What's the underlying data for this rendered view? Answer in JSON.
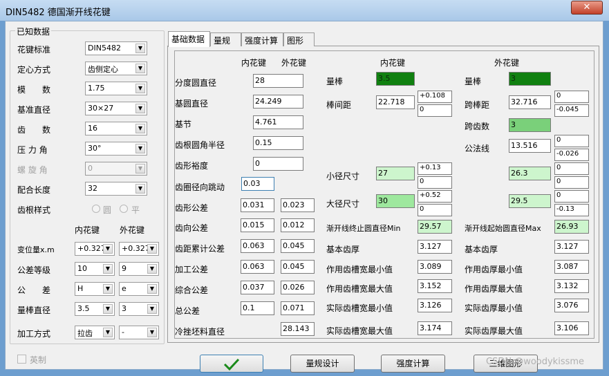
{
  "window": {
    "title": "DIN5482 德国渐开线花键",
    "close_icon": "✕"
  },
  "known": {
    "title": "已知数据",
    "labels": {
      "std": "花键标准",
      "center": "定心方式",
      "module": "模　　数",
      "base_d": "基准直径",
      "teeth": "齿　　数",
      "pressure": "压 力 角",
      "helix": "螺 旋 角",
      "length": "配合长度",
      "root_style": "齿根样式"
    },
    "values": {
      "std": "DIN5482",
      "center": "齿侧定心",
      "module": "1.75",
      "base_d": "30×27",
      "teeth": "16",
      "pressure": "30°",
      "helix": "0",
      "length": "32"
    },
    "root_opts": {
      "round": "圆",
      "flat": "平"
    },
    "col_inner": "内花键",
    "col_outer": "外花键",
    "rows": {
      "shift": "变位量x.m",
      "grade": "公差等级",
      "tol": "公　　差",
      "meas": "量棒直径",
      "proc": "加工方式"
    },
    "inner": {
      "shift": "+0.327",
      "grade": "10",
      "tol": "H",
      "meas": "3.5",
      "proc": "拉齿"
    },
    "outer": {
      "shift": "+0.327",
      "grade": "9",
      "tol": "e",
      "meas": "3",
      "proc": "-"
    },
    "english": "英制"
  },
  "tabs": [
    "基础数据",
    "量规",
    "强度计算",
    "图形"
  ],
  "basic": {
    "col_inner": "内花键",
    "col_outer": "外花键",
    "labels": {
      "pitch_d": "分度圆直径",
      "base_d": "基圆直径",
      "pitch": "基节",
      "root_r": "齿根圆角半径",
      "form_clear": "齿形裕度",
      "runout": "齿圈径向跳动",
      "profile_tol": "齿形公差",
      "lead_tol": "齿向公差",
      "cum_tol": "齿距累计公差",
      "mfg_tol": "加工公差",
      "comp_tol": "综合公差",
      "total_tol": "总公差",
      "blank_d": "冷挫坯料直径"
    },
    "pitch_d": "28",
    "base_d": "24.249",
    "pitch": "4.761",
    "root_r": "0.15",
    "form_clear": "0",
    "runout": "0.03",
    "profile_tol": [
      "0.031",
      "0.023"
    ],
    "lead_tol": [
      "0.015",
      "0.012"
    ],
    "cum_tol": [
      "0.063",
      "0.045"
    ],
    "mfg_tol": [
      "0.063",
      "0.045"
    ],
    "comp_tol": [
      "0.037",
      "0.026"
    ],
    "total_tol": [
      "0.1",
      "0.071"
    ],
    "blank_d": "28.143"
  },
  "inner_spline": {
    "head": "内花键",
    "labels": {
      "pin": "量棒",
      "over_pins": "棒间距",
      "minor": "小径尺寸",
      "major": "大径尺寸",
      "end_d": "渐开线终止圆直径Min",
      "basic_w": "基本齿厚",
      "eff_min": "作用齿槽宽最小值",
      "eff_max": "作用齿槽宽最大值",
      "act_min": "实际齿槽宽最小值",
      "act_max": "实际齿槽宽最大值"
    },
    "pin": "3.5",
    "over_pins": "22.718",
    "over_pins_up": "+0.108",
    "over_pins_lo": "0",
    "minor": "27",
    "minor_up": "+0.13",
    "minor_lo": "0",
    "major": "30",
    "major_up": "+0.52",
    "major_lo": "0",
    "end_d": "29.57",
    "basic_w": "3.127",
    "eff_min": "3.089",
    "eff_max": "3.152",
    "act_min": "3.126",
    "act_max": "3.174"
  },
  "outer_spline": {
    "head": "外花键",
    "labels": {
      "pin": "量棒",
      "span": "跨棒距",
      "span_teeth": "跨齿数",
      "common_normal": "公法线",
      "start_d": "渐开线起始圆直径Max",
      "basic_t": "基本齿厚",
      "eff_min": "作用齿厚最小值",
      "eff_max": "作用齿厚最大值",
      "act_min": "实际齿厚最小值",
      "act_max": "实际齿厚最大值"
    },
    "pin": "3",
    "span": "32.716",
    "span_up": "0",
    "span_lo": "-0.045",
    "span_teeth": "3",
    "common_normal": "13.516",
    "cn_up": "0",
    "cn_lo": "-0.026",
    "minor": "26.3",
    "minor_up": "0",
    "minor_lo": "0",
    "major": "29.5",
    "major_up": "0",
    "major_lo": "-0.13",
    "start_d": "26.93",
    "basic_t": "3.127",
    "eff_min": "3.087",
    "eff_max": "3.132",
    "act_min": "3.076",
    "act_max": "3.106"
  },
  "buttons": {
    "ok_icon": "check-icon",
    "gauge": "量规设计",
    "strength": "强度计算",
    "drawing": "三维图形"
  },
  "watermark": "CSDN @woodykissme"
}
